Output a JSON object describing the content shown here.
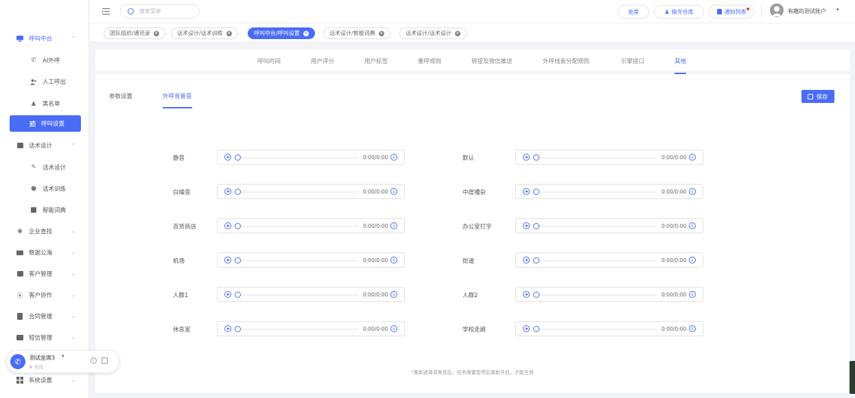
{
  "topbar": {
    "search_placeholder": "搜索菜单",
    "btn_seat": "坐席",
    "btn_command": "指令仓库",
    "btn_notify": "通知列表",
    "account_name": "有趣的测试账户"
  },
  "sidebar": {
    "call_center": "呼叫中台",
    "ai_call": "AI外呼",
    "manual_call": "人工呼出",
    "blacklist": "黑名单",
    "call_settings": "呼叫设置",
    "script_design_group": "话术设计",
    "script_design": "话术设计",
    "script_training": "话术训练",
    "smart_dict": "智能词典",
    "company_search": "企业查找",
    "data_sea": "数据公海",
    "customer_mgmt": "客户管理",
    "customer_collab": "客户协作",
    "contract_mgmt": "合同管理",
    "sms_mgmt": "短信管理",
    "system_settings": "系统设置"
  },
  "page_tabs": [
    {
      "label": "团队组织/通讯录"
    },
    {
      "label": "话术设计/话术训练"
    },
    {
      "label": "呼叫中台/呼叫设置"
    },
    {
      "label": "话术设计/智能词典"
    },
    {
      "label": "话术设计/话术设计"
    }
  ],
  "nav_tabs": [
    "呼叫时间",
    "用户评分",
    "用户标签",
    "重呼规则",
    "转接及微信推送",
    "外呼线索分配规则",
    "引擎接口",
    "其他"
  ],
  "sub_tabs": [
    "参数设置",
    "外呼背景音"
  ],
  "save_label": "保存",
  "sounds": [
    {
      "label": "静音",
      "time": "0:00/0:00"
    },
    {
      "label": "默认",
      "time": "0:00/0:00"
    },
    {
      "label": "白噪音",
      "time": "0:00/0:00"
    },
    {
      "label": "中度嘈杂",
      "time": "0:00/0:00"
    },
    {
      "label": "百货商店",
      "time": "0:00/0:00"
    },
    {
      "label": "办公室打字",
      "time": "0:00/0:00"
    },
    {
      "label": "机场",
      "time": "0:00/0:00"
    },
    {
      "label": "街道",
      "time": "0:00/0:00"
    },
    {
      "label": "人群1",
      "time": "0:00/0:00"
    },
    {
      "label": "人群2",
      "time": "0:00/0:00"
    },
    {
      "label": "休息室",
      "time": "0:00/0:00"
    },
    {
      "label": "学校走廊",
      "time": "0:00/0:00"
    }
  ],
  "footer_note": "*重新选择背景音后，任务需要暂停后重新开启，才能生效",
  "seat_widget": {
    "name": "测试坐席3",
    "status": "离线"
  },
  "colors": {
    "accent": "#4a6cf7",
    "notify_dot": "#e53935"
  }
}
